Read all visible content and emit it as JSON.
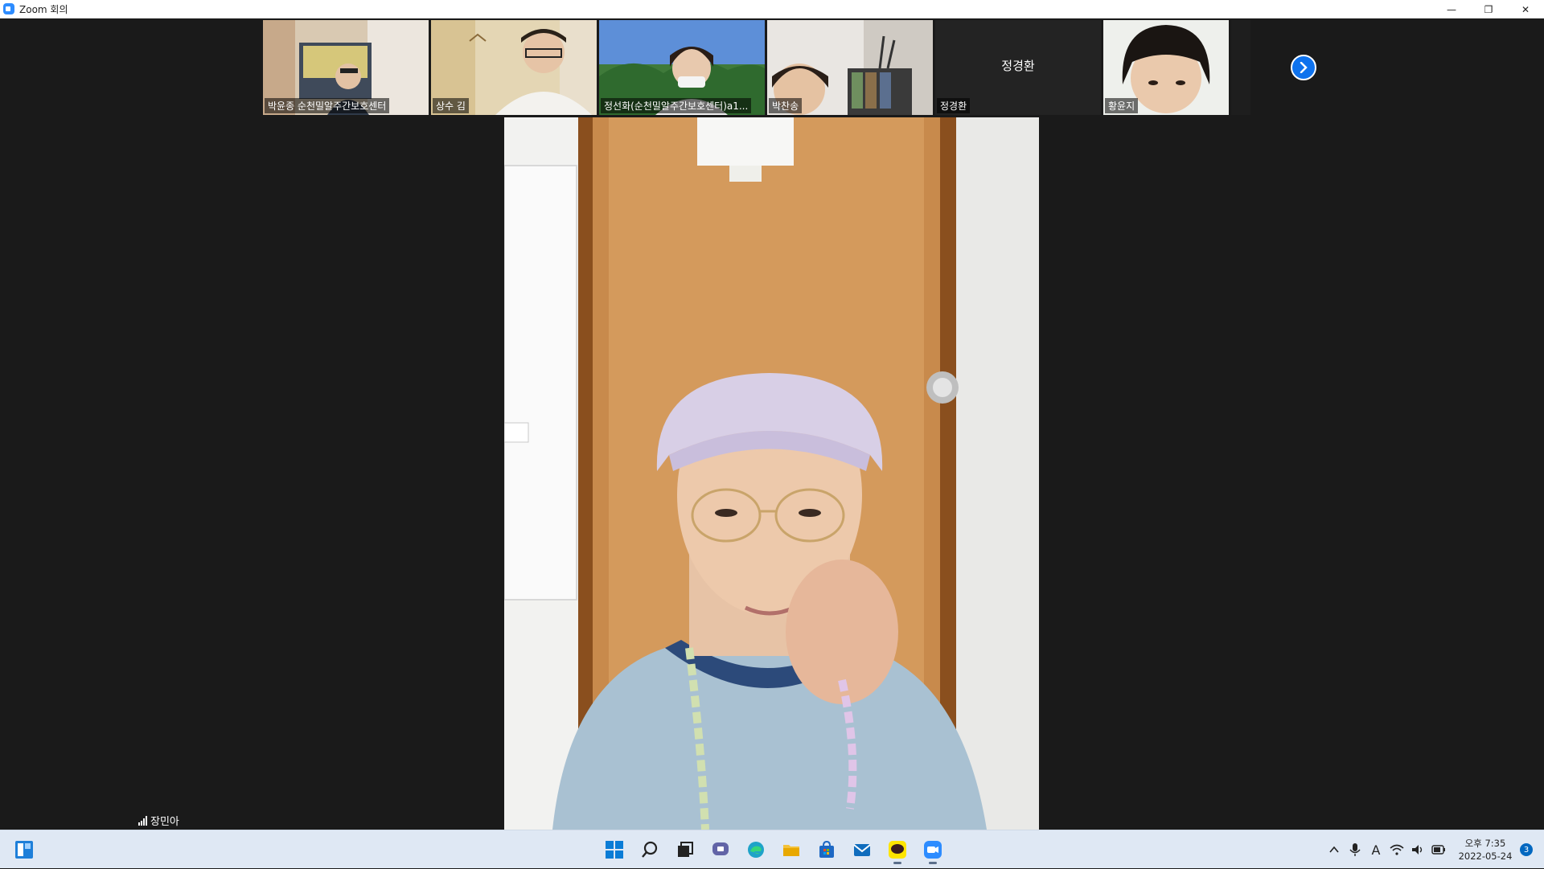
{
  "window": {
    "title": "Zoom 회의",
    "minimize": "—",
    "restore": "❐",
    "close": "✕"
  },
  "participants": [
    {
      "name": "박윤종 순천밀알주간보호센터",
      "has_video": true
    },
    {
      "name": "상수 김",
      "has_video": true
    },
    {
      "name": "정선화(순천밀알주간보호센터)a1...",
      "has_video": true
    },
    {
      "name": "박찬송",
      "has_video": true
    },
    {
      "name": "정경환",
      "has_video": false,
      "center_name": "정경환"
    },
    {
      "name": "황윤지",
      "has_video": true
    }
  ],
  "active_speaker": {
    "name": "장민아"
  },
  "taskbar": {
    "tray": {
      "ime": "A"
    },
    "clock": {
      "time": "오후 7:35",
      "date": "2022-05-24"
    },
    "notification_count": "3"
  },
  "colors": {
    "zoom_blue": "#2d8cff",
    "next_button": "#0e72ed",
    "meeting_bg": "#1a1a1a",
    "taskbar_bg": "#dfe8f4"
  }
}
